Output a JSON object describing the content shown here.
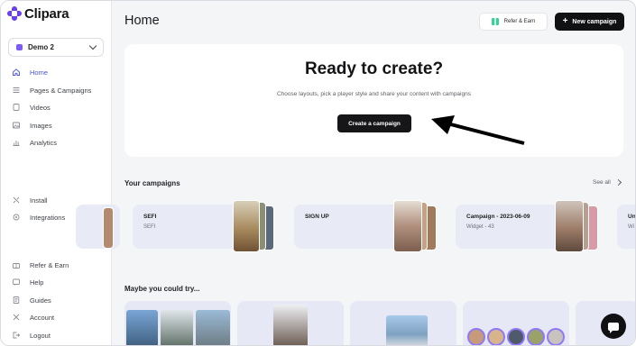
{
  "app": {
    "name": "Clipara"
  },
  "workspace": {
    "label": "Demo 2"
  },
  "sidebar": {
    "primary": [
      {
        "label": "Home",
        "icon": "home-icon",
        "active": true
      },
      {
        "label": "Pages & Campaigns",
        "icon": "list-icon"
      },
      {
        "label": "Videos",
        "icon": "video-icon"
      },
      {
        "label": "Images",
        "icon": "image-icon"
      },
      {
        "label": "Analytics",
        "icon": "analytics-icon"
      }
    ],
    "secondary": [
      {
        "label": "Install",
        "icon": "install-icon"
      },
      {
        "label": "Integrations",
        "icon": "integrations-icon"
      }
    ],
    "footer": [
      {
        "label": "Refer & Earn",
        "icon": "gift-icon"
      },
      {
        "label": "Help",
        "icon": "help-icon"
      },
      {
        "label": "Guides",
        "icon": "guides-icon"
      },
      {
        "label": "Account",
        "icon": "account-icon"
      },
      {
        "label": "Logout",
        "icon": "logout-icon"
      }
    ]
  },
  "header": {
    "title": "Home",
    "refer_label": "Refer & Earn",
    "new_campaign_label": "New campaign"
  },
  "hero": {
    "title": "Ready to create?",
    "subtitle": "Choose layouts, pick a player style and share your content with campaigns",
    "button_label": "Create a campaign"
  },
  "campaigns": {
    "title": "Your campaigns",
    "see_all": "See all",
    "items": [
      {
        "name": "SEFI",
        "meta": "SEFI"
      },
      {
        "name": "SIGN UP",
        "meta": ""
      },
      {
        "name": "Campaign - 2023-06-09",
        "meta": "Widget - 43"
      },
      {
        "name": "Un",
        "meta": "Wi"
      }
    ]
  },
  "suggestions": {
    "title": "Maybe you could try..."
  },
  "colors": {
    "accent": "#4a53d8",
    "brand": "#6b3df5",
    "card_bg": "#e8ebf5",
    "button_dark": "#111114"
  }
}
